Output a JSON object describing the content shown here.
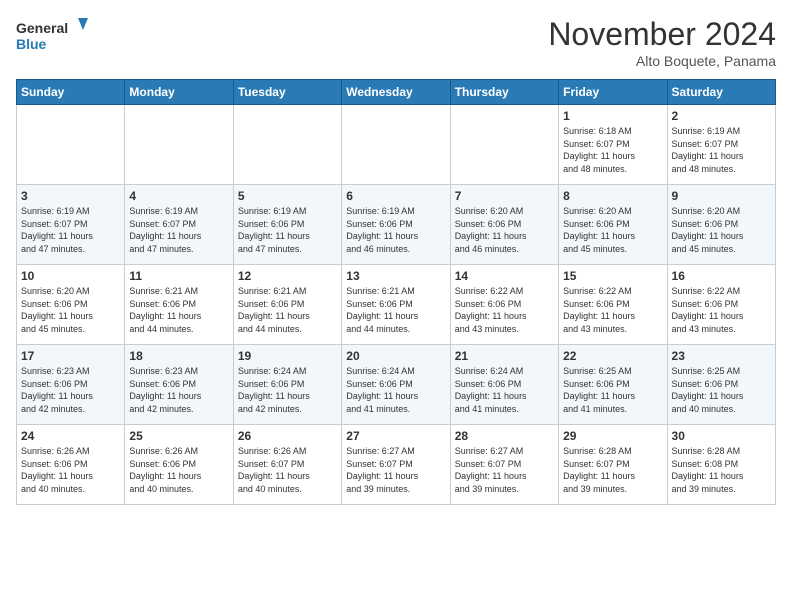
{
  "header": {
    "logo_general": "General",
    "logo_blue": "Blue",
    "month": "November 2024",
    "location": "Alto Boquete, Panama"
  },
  "days_of_week": [
    "Sunday",
    "Monday",
    "Tuesday",
    "Wednesday",
    "Thursday",
    "Friday",
    "Saturday"
  ],
  "weeks": [
    [
      {
        "day": "",
        "info": ""
      },
      {
        "day": "",
        "info": ""
      },
      {
        "day": "",
        "info": ""
      },
      {
        "day": "",
        "info": ""
      },
      {
        "day": "",
        "info": ""
      },
      {
        "day": "1",
        "info": "Sunrise: 6:18 AM\nSunset: 6:07 PM\nDaylight: 11 hours\nand 48 minutes."
      },
      {
        "day": "2",
        "info": "Sunrise: 6:19 AM\nSunset: 6:07 PM\nDaylight: 11 hours\nand 48 minutes."
      }
    ],
    [
      {
        "day": "3",
        "info": "Sunrise: 6:19 AM\nSunset: 6:07 PM\nDaylight: 11 hours\nand 47 minutes."
      },
      {
        "day": "4",
        "info": "Sunrise: 6:19 AM\nSunset: 6:07 PM\nDaylight: 11 hours\nand 47 minutes."
      },
      {
        "day": "5",
        "info": "Sunrise: 6:19 AM\nSunset: 6:06 PM\nDaylight: 11 hours\nand 47 minutes."
      },
      {
        "day": "6",
        "info": "Sunrise: 6:19 AM\nSunset: 6:06 PM\nDaylight: 11 hours\nand 46 minutes."
      },
      {
        "day": "7",
        "info": "Sunrise: 6:20 AM\nSunset: 6:06 PM\nDaylight: 11 hours\nand 46 minutes."
      },
      {
        "day": "8",
        "info": "Sunrise: 6:20 AM\nSunset: 6:06 PM\nDaylight: 11 hours\nand 45 minutes."
      },
      {
        "day": "9",
        "info": "Sunrise: 6:20 AM\nSunset: 6:06 PM\nDaylight: 11 hours\nand 45 minutes."
      }
    ],
    [
      {
        "day": "10",
        "info": "Sunrise: 6:20 AM\nSunset: 6:06 PM\nDaylight: 11 hours\nand 45 minutes."
      },
      {
        "day": "11",
        "info": "Sunrise: 6:21 AM\nSunset: 6:06 PM\nDaylight: 11 hours\nand 44 minutes."
      },
      {
        "day": "12",
        "info": "Sunrise: 6:21 AM\nSunset: 6:06 PM\nDaylight: 11 hours\nand 44 minutes."
      },
      {
        "day": "13",
        "info": "Sunrise: 6:21 AM\nSunset: 6:06 PM\nDaylight: 11 hours\nand 44 minutes."
      },
      {
        "day": "14",
        "info": "Sunrise: 6:22 AM\nSunset: 6:06 PM\nDaylight: 11 hours\nand 43 minutes."
      },
      {
        "day": "15",
        "info": "Sunrise: 6:22 AM\nSunset: 6:06 PM\nDaylight: 11 hours\nand 43 minutes."
      },
      {
        "day": "16",
        "info": "Sunrise: 6:22 AM\nSunset: 6:06 PM\nDaylight: 11 hours\nand 43 minutes."
      }
    ],
    [
      {
        "day": "17",
        "info": "Sunrise: 6:23 AM\nSunset: 6:06 PM\nDaylight: 11 hours\nand 42 minutes."
      },
      {
        "day": "18",
        "info": "Sunrise: 6:23 AM\nSunset: 6:06 PM\nDaylight: 11 hours\nand 42 minutes."
      },
      {
        "day": "19",
        "info": "Sunrise: 6:24 AM\nSunset: 6:06 PM\nDaylight: 11 hours\nand 42 minutes."
      },
      {
        "day": "20",
        "info": "Sunrise: 6:24 AM\nSunset: 6:06 PM\nDaylight: 11 hours\nand 41 minutes."
      },
      {
        "day": "21",
        "info": "Sunrise: 6:24 AM\nSunset: 6:06 PM\nDaylight: 11 hours\nand 41 minutes."
      },
      {
        "day": "22",
        "info": "Sunrise: 6:25 AM\nSunset: 6:06 PM\nDaylight: 11 hours\nand 41 minutes."
      },
      {
        "day": "23",
        "info": "Sunrise: 6:25 AM\nSunset: 6:06 PM\nDaylight: 11 hours\nand 40 minutes."
      }
    ],
    [
      {
        "day": "24",
        "info": "Sunrise: 6:26 AM\nSunset: 6:06 PM\nDaylight: 11 hours\nand 40 minutes."
      },
      {
        "day": "25",
        "info": "Sunrise: 6:26 AM\nSunset: 6:06 PM\nDaylight: 11 hours\nand 40 minutes."
      },
      {
        "day": "26",
        "info": "Sunrise: 6:26 AM\nSunset: 6:07 PM\nDaylight: 11 hours\nand 40 minutes."
      },
      {
        "day": "27",
        "info": "Sunrise: 6:27 AM\nSunset: 6:07 PM\nDaylight: 11 hours\nand 39 minutes."
      },
      {
        "day": "28",
        "info": "Sunrise: 6:27 AM\nSunset: 6:07 PM\nDaylight: 11 hours\nand 39 minutes."
      },
      {
        "day": "29",
        "info": "Sunrise: 6:28 AM\nSunset: 6:07 PM\nDaylight: 11 hours\nand 39 minutes."
      },
      {
        "day": "30",
        "info": "Sunrise: 6:28 AM\nSunset: 6:08 PM\nDaylight: 11 hours\nand 39 minutes."
      }
    ]
  ]
}
